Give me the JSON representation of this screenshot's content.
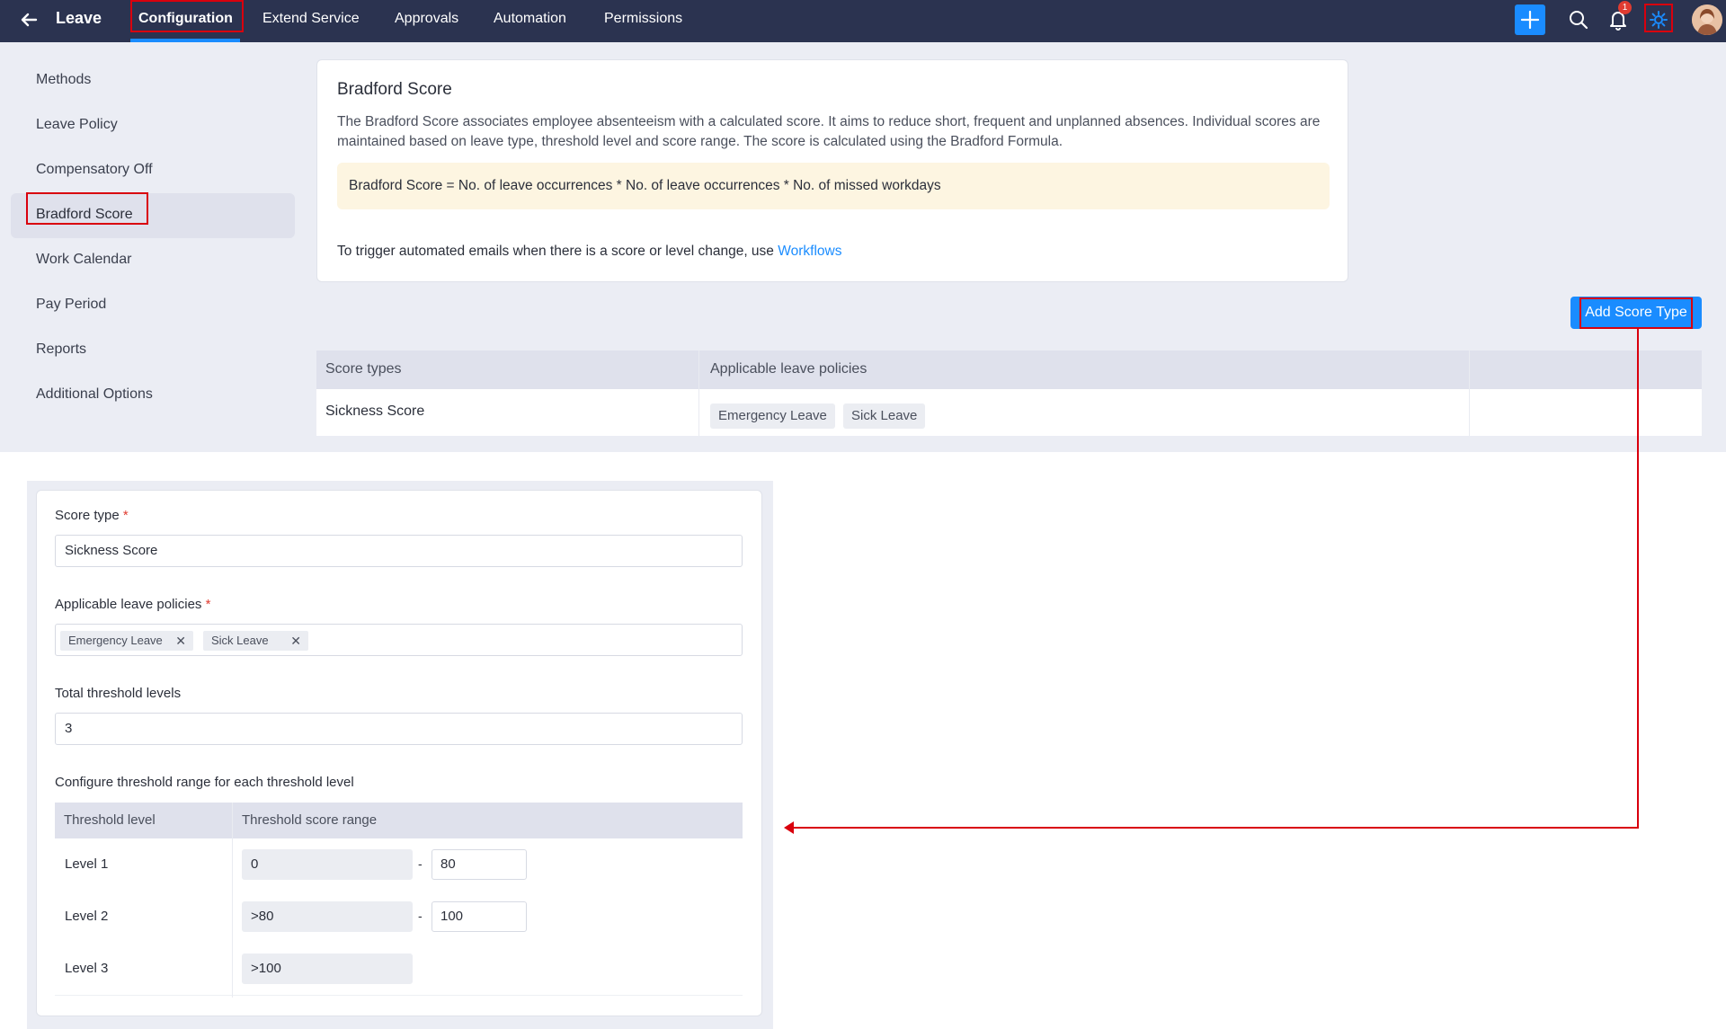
{
  "topbar": {
    "app_title": "Leave",
    "nav": [
      "Configuration",
      "Extend Service",
      "Approvals",
      "Automation",
      "Permissions"
    ],
    "notification_count": "1",
    "icons": [
      "back-arrow-icon",
      "plus-icon",
      "search-icon",
      "bell-icon",
      "gear-icon",
      "avatar"
    ],
    "accent_color": "#1a8cff",
    "bar_color": "#2b3350"
  },
  "sidebar": {
    "items": [
      "Methods",
      "Leave Policy",
      "Compensatory Off",
      "Bradford Score",
      "Work Calendar",
      "Pay Period",
      "Reports",
      "Additional Options"
    ],
    "active": "Bradford Score"
  },
  "info_card": {
    "title": "Bradford Score",
    "description": "The Bradford Score associates employee absenteeism with a calculated score. It aims to reduce short, frequent and unplanned absences. Individual scores are maintained based on leave type, threshold level and score range. The score is calculated using the Bradford Formula.",
    "formula": "Bradford Score = No. of leave occurrences * No. of leave occurrences * No. of missed workdays",
    "trigger_text": "To trigger automated emails when there is a score or level change, use",
    "trigger_link": "Workflows"
  },
  "add_button_label": "Add Score Type",
  "score_table": {
    "headers": [
      "Score types",
      "Applicable leave policies",
      ""
    ],
    "rows": [
      {
        "score_type": "Sickness Score",
        "policies": [
          "Emergency Leave",
          "Sick Leave"
        ]
      }
    ]
  },
  "form": {
    "score_type_label": "Score type",
    "score_type_value": "Sickness Score",
    "policies_label": "Applicable leave policies",
    "policies_tags": [
      "Emergency Leave",
      "Sick Leave"
    ],
    "threshold_levels_label": "Total threshold levels",
    "threshold_levels_value": "3",
    "range_section_label": "Configure threshold range for each threshold level",
    "range_table": {
      "headers": [
        "Threshold level",
        "Threshold score range"
      ],
      "rows": [
        {
          "level": "Level 1",
          "from": "0",
          "to": "80"
        },
        {
          "level": "Level 2",
          "from": ">80",
          "to": "100"
        },
        {
          "level": "Level 3",
          "from": ">100",
          "to": ""
        }
      ]
    }
  }
}
